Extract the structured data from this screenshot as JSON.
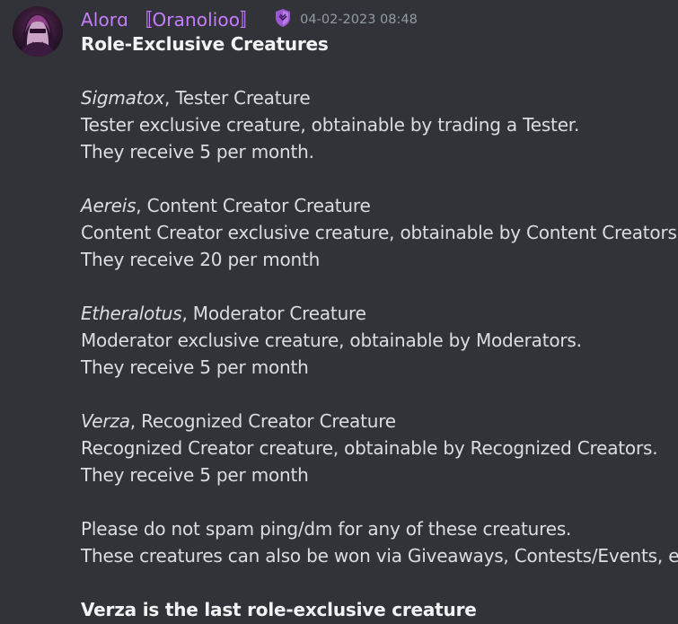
{
  "author": {
    "name": "Alorɑ 〚Oranolioo〛",
    "avatar_icon": "user-avatar",
    "role_icon": "shield-icon",
    "name_color": "#c77dff"
  },
  "timestamp": "04-02-2023 08:48",
  "message": {
    "title": "Role-Exclusive Creatures",
    "creatures": [
      {
        "name": "Sigmatox",
        "role_text": ", Tester Creature",
        "description": "Tester exclusive creature, obtainable by trading a Tester.",
        "rate": "They receive 5 per month."
      },
      {
        "name": "Aereis",
        "role_text": ", Content Creator Creature",
        "description": "Content Creator exclusive creature, obtainable by Content Creators.",
        "rate": "They receive 20 per month"
      },
      {
        "name": "Etheralotus",
        "role_text": ", Moderator Creature",
        "description": "Moderator exclusive creature, obtainable by Moderators.",
        "rate": "They receive 5 per month"
      },
      {
        "name": "Verza",
        "role_text": ", Recognized Creator Creature",
        "description": "Recognized Creator creature, obtainable by Recognized Creators.",
        "rate": "They receive 5 per month"
      }
    ],
    "notice_1": "Please do not spam ping/dm for any of these creatures.",
    "notice_2": "These creatures can also be won via Giveaways, Contests/Events, etc.",
    "footer": "Verza is the last role-exclusive creature"
  }
}
